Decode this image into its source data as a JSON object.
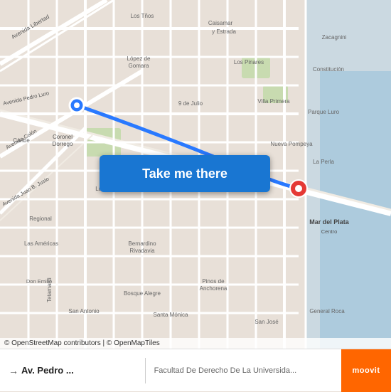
{
  "map": {
    "button_label": "Take me there",
    "attribution": "© OpenStreetMap contributors | © OpenMapTiles"
  },
  "bottom_bar": {
    "from_label": "Av. Pedro ...",
    "to_label": "Facultad De Derecho De La Universida...",
    "moovit_label": "moovit"
  },
  "colors": {
    "button_bg": "#1976d2",
    "moovit_bg": "#ff6600",
    "route_line": "#2979ff",
    "start_marker": "#2979ff",
    "end_marker": "#e53935",
    "road_major": "#ffffff",
    "road_minor": "#f5f0e8",
    "map_bg": "#e8e0d8",
    "green_area": "#c8dbb0"
  }
}
